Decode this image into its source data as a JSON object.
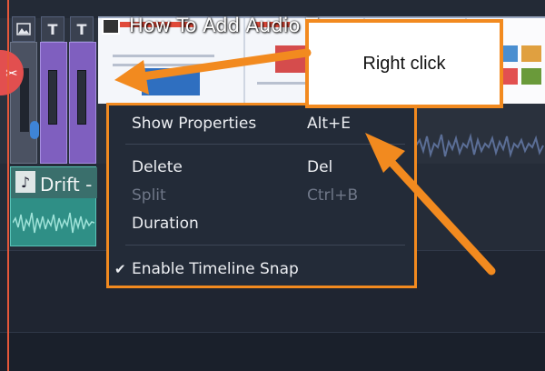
{
  "video_clip": {
    "title": "How To Add Audio T"
  },
  "audio_clip": {
    "title": "Drift -"
  },
  "track_icons": {
    "image": "image-icon",
    "text1": "T",
    "text2": "T"
  },
  "context_menu": {
    "items": [
      {
        "label": "Show Properties",
        "shortcut": "Alt+E",
        "enabled": true
      },
      {
        "label": "Delete",
        "shortcut": "Del",
        "enabled": true
      },
      {
        "label": "Split",
        "shortcut": "Ctrl+B",
        "enabled": false
      },
      {
        "label": "Duration",
        "shortcut": "",
        "enabled": true
      },
      {
        "label": "Enable Timeline Snap",
        "shortcut": "",
        "enabled": true,
        "checked": true
      }
    ],
    "check_glyph": "✔"
  },
  "callout": {
    "text": "Right click"
  },
  "colors": {
    "accent": "#f28a1f",
    "playhead": "#e5573a",
    "menu_bg": "#232b38",
    "audio_clip": "#2f8f86",
    "text_clip": "#7f5fbf"
  }
}
